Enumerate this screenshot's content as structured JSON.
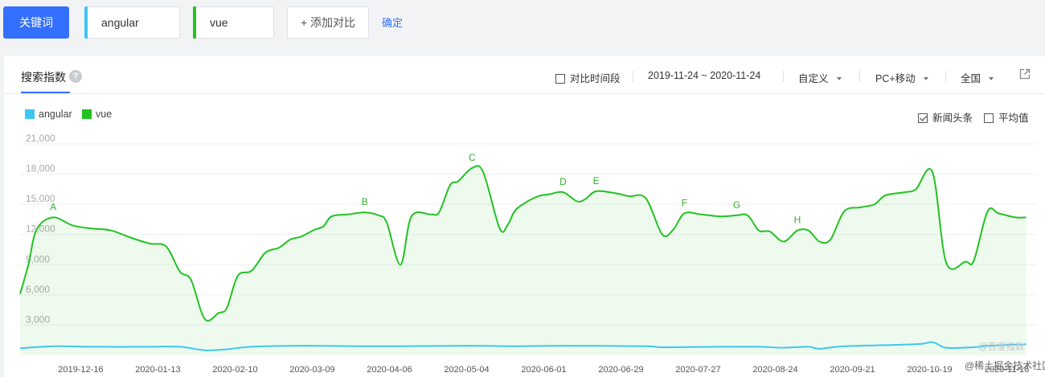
{
  "topbar": {
    "keyword_button": "关键词",
    "keywords": [
      {
        "text": "angular",
        "color": "#3ec6f2"
      },
      {
        "text": "vue",
        "color": "#23c223"
      }
    ],
    "add_compare": "+ 添加对比",
    "confirm": "确定"
  },
  "panel": {
    "tab_label": "搜索指数",
    "help_icon": "question-circle-icon",
    "compare_period": "对比时间段",
    "date_range": "2019-11-24 ~ 2020-11-24",
    "custom": "自定义",
    "device": "PC+移动",
    "region": "全国",
    "external_icon": "external-link-icon"
  },
  "legend": [
    {
      "name": "angular",
      "color": "#3ec6f2"
    },
    {
      "name": "vue",
      "color": "#23c223"
    }
  ],
  "options": {
    "news_headlines": "新闻头条",
    "news_checked": true,
    "average": "平均值",
    "average_checked": false
  },
  "watermark": "@百度指数",
  "site_watermark": "@稀土掘金技术社区",
  "chart_data": {
    "type": "line",
    "ylim": [
      0,
      21000
    ],
    "yticks": [
      "21,000",
      "18,000",
      "15,000",
      "12,000",
      "9,000",
      "6,000",
      "3,000"
    ],
    "ytick_values": [
      21000,
      18000,
      15000,
      12000,
      9000,
      6000,
      3000
    ],
    "xticks": [
      "2019-12-16",
      "2020-01-13",
      "2020-02-10",
      "2020-03-09",
      "2020-04-06",
      "2020-05-04",
      "2020-06-01",
      "2020-06-29",
      "2020-07-27",
      "2020-08-24",
      "2020-09-21",
      "2020-10-19",
      "2020-11-16"
    ],
    "x_start": "2019-11-24",
    "x_end": "2020-11-24",
    "series": [
      {
        "name": "vue",
        "color": "#23c223",
        "fill": true,
        "points": [
          [
            "2019-11-24",
            6100
          ],
          [
            "2019-11-27",
            9000
          ],
          [
            "2019-11-30",
            12500
          ],
          [
            "2019-12-06",
            13700
          ],
          [
            "2019-12-13",
            12900
          ],
          [
            "2019-12-20",
            12600
          ],
          [
            "2019-12-27",
            12400
          ],
          [
            "2020-01-03",
            11700
          ],
          [
            "2020-01-10",
            11100
          ],
          [
            "2020-01-16",
            10800
          ],
          [
            "2020-01-21",
            8300
          ],
          [
            "2020-01-25",
            7500
          ],
          [
            "2020-01-30",
            3600
          ],
          [
            "2020-02-04",
            4200
          ],
          [
            "2020-02-07",
            4700
          ],
          [
            "2020-02-11",
            7900
          ],
          [
            "2020-02-16",
            8400
          ],
          [
            "2020-02-21",
            10200
          ],
          [
            "2020-02-26",
            10700
          ],
          [
            "2020-03-01",
            11500
          ],
          [
            "2020-03-05",
            11800
          ],
          [
            "2020-03-10",
            12500
          ],
          [
            "2020-03-13",
            12800
          ],
          [
            "2020-03-16",
            13800
          ],
          [
            "2020-03-22",
            14000
          ],
          [
            "2020-03-28",
            14200
          ],
          [
            "2020-04-02",
            13900
          ],
          [
            "2020-04-05",
            13200
          ],
          [
            "2020-04-10",
            9000
          ],
          [
            "2020-04-14",
            13800
          ],
          [
            "2020-04-21",
            14000
          ],
          [
            "2020-04-24",
            14200
          ],
          [
            "2020-04-28",
            16900
          ],
          [
            "2020-05-01",
            17300
          ],
          [
            "2020-05-06",
            18600
          ],
          [
            "2020-05-10",
            18200
          ],
          [
            "2020-05-16",
            12600
          ],
          [
            "2020-05-19",
            13000
          ],
          [
            "2020-05-22",
            14500
          ],
          [
            "2020-05-29",
            15700
          ],
          [
            "2020-06-03",
            16000
          ],
          [
            "2020-06-08",
            16200
          ],
          [
            "2020-06-13",
            15300
          ],
          [
            "2020-06-16",
            15500
          ],
          [
            "2020-06-20",
            16300
          ],
          [
            "2020-06-27",
            16100
          ],
          [
            "2020-07-02",
            15800
          ],
          [
            "2020-07-08",
            15600
          ],
          [
            "2020-07-14",
            12000
          ],
          [
            "2020-07-18",
            12500
          ],
          [
            "2020-07-22",
            14100
          ],
          [
            "2020-07-28",
            14000
          ],
          [
            "2020-08-04",
            13800
          ],
          [
            "2020-08-10",
            13900
          ],
          [
            "2020-08-14",
            13900
          ],
          [
            "2020-08-18",
            12400
          ],
          [
            "2020-08-22",
            12300
          ],
          [
            "2020-08-27",
            11300
          ],
          [
            "2020-09-01",
            12400
          ],
          [
            "2020-09-05",
            12400
          ],
          [
            "2020-09-09",
            11300
          ],
          [
            "2020-09-13",
            11500
          ],
          [
            "2020-09-18",
            14300
          ],
          [
            "2020-09-24",
            14700
          ],
          [
            "2020-09-29",
            15000
          ],
          [
            "2020-10-03",
            15900
          ],
          [
            "2020-10-10",
            16200
          ],
          [
            "2020-10-14",
            16500
          ],
          [
            "2020-10-20",
            18200
          ],
          [
            "2020-10-25",
            9200
          ],
          [
            "2020-11-01",
            9300
          ],
          [
            "2020-11-04",
            9400
          ],
          [
            "2020-11-09",
            14300
          ],
          [
            "2020-11-13",
            14100
          ],
          [
            "2020-11-19",
            13700
          ],
          [
            "2020-11-23",
            13700
          ]
        ]
      },
      {
        "name": "angular",
        "color": "#3ec6f2",
        "fill": false,
        "points": [
          [
            "2019-11-24",
            700
          ],
          [
            "2019-12-06",
            900
          ],
          [
            "2019-12-20",
            850
          ],
          [
            "2020-01-10",
            850
          ],
          [
            "2020-01-21",
            850
          ],
          [
            "2020-01-30",
            500
          ],
          [
            "2020-02-07",
            600
          ],
          [
            "2020-02-16",
            850
          ],
          [
            "2020-03-05",
            950
          ],
          [
            "2020-03-28",
            900
          ],
          [
            "2020-04-10",
            900
          ],
          [
            "2020-05-06",
            950
          ],
          [
            "2020-05-20",
            900
          ],
          [
            "2020-06-08",
            950
          ],
          [
            "2020-07-08",
            900
          ],
          [
            "2020-07-14",
            800
          ],
          [
            "2020-08-04",
            850
          ],
          [
            "2020-08-18",
            850
          ],
          [
            "2020-08-27",
            750
          ],
          [
            "2020-09-05",
            850
          ],
          [
            "2020-09-09",
            650
          ],
          [
            "2020-09-18",
            900
          ],
          [
            "2020-10-14",
            1100
          ],
          [
            "2020-10-20",
            1300
          ],
          [
            "2020-10-25",
            750
          ],
          [
            "2020-11-04",
            800
          ],
          [
            "2020-11-09",
            950
          ],
          [
            "2020-11-23",
            1100
          ]
        ]
      }
    ],
    "annotations": [
      {
        "label": "A",
        "date": "2019-12-06",
        "value": 13700
      },
      {
        "label": "B",
        "date": "2020-03-28",
        "value": 14200
      },
      {
        "label": "C",
        "date": "2020-05-06",
        "value": 18600
      },
      {
        "label": "D",
        "date": "2020-06-08",
        "value": 16200
      },
      {
        "label": "E",
        "date": "2020-06-20",
        "value": 16300
      },
      {
        "label": "F",
        "date": "2020-07-22",
        "value": 14100
      },
      {
        "label": "G",
        "date": "2020-08-10",
        "value": 13900
      },
      {
        "label": "H",
        "date": "2020-09-01",
        "value": 12400
      }
    ],
    "grid": true,
    "legend_position": "top-left"
  }
}
